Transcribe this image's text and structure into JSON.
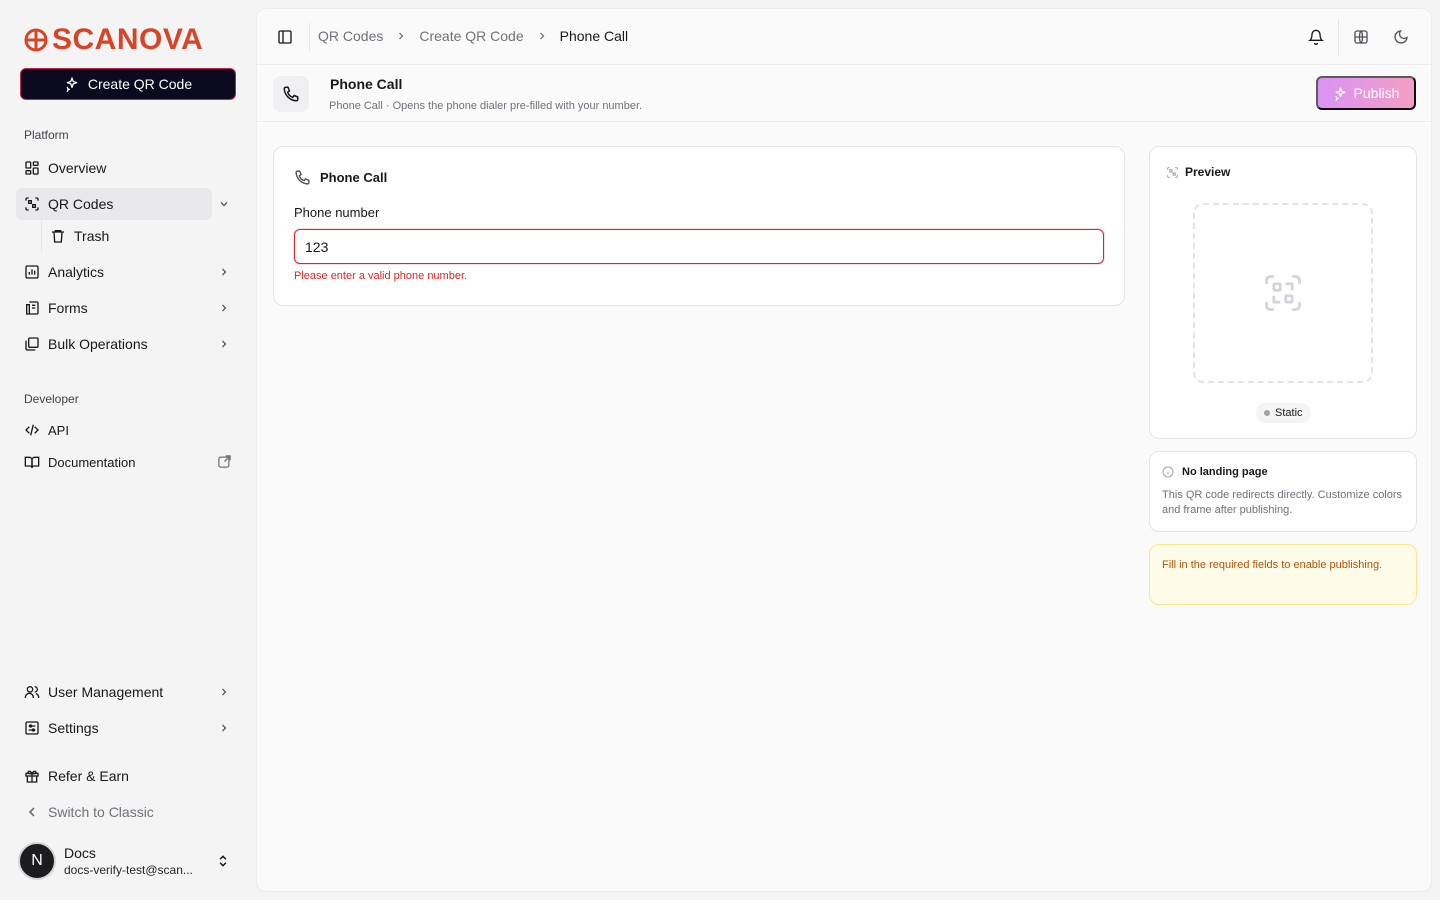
{
  "brand": {
    "name": "SCANOVA",
    "color": "#d64526"
  },
  "sidebar": {
    "create_label": "Create QR Code",
    "platform_label": "Platform",
    "developer_label": "Developer",
    "items": {
      "overview": "Overview",
      "qr_codes": "QR Codes",
      "trash": "Trash",
      "analytics": "Analytics",
      "forms": "Forms",
      "bulk": "Bulk Operations",
      "api": "API",
      "docs": "Documentation",
      "users": "User Management",
      "settings": "Settings",
      "refer": "Refer & Earn",
      "classic": "Switch to Classic"
    },
    "user": {
      "initial": "N",
      "name": "Docs",
      "email": "docs-verify-test@scan..."
    }
  },
  "topbar": {
    "breadcrumb": [
      "QR Codes",
      "Create QR Code",
      "Phone Call"
    ]
  },
  "header": {
    "title": "Phone Call",
    "subtitle": "Phone Call · Opens the phone dialer pre-filled with your number.",
    "publish_label": "Publish"
  },
  "form": {
    "title": "Phone Call",
    "field_label": "Phone number",
    "field_value": "123",
    "error": "Please enter a valid phone number."
  },
  "preview": {
    "title": "Preview",
    "badge": "Static"
  },
  "landing": {
    "title": "No landing page",
    "text": "This QR code redirects directly. Customize colors and frame after publishing."
  },
  "warning": {
    "text": "Fill in the required fields to enable publishing."
  }
}
